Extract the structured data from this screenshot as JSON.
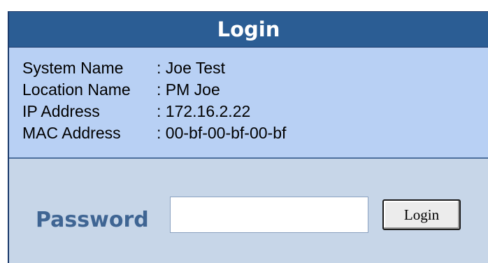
{
  "header": {
    "title": "Login"
  },
  "system_info": {
    "rows": [
      {
        "label": "System Name",
        "value": ": Joe Test"
      },
      {
        "label": "Location Name",
        "value": ": PM Joe"
      },
      {
        "label": "IP Address",
        "value": ": 172.16.2.22"
      },
      {
        "label": "MAC Address",
        "value": ": 00-bf-00-bf-00-bf"
      }
    ]
  },
  "login_form": {
    "password_label": "Password",
    "password_value": "",
    "login_button_label": "Login"
  },
  "colors": {
    "title_bar": "#2b5d94",
    "info_background": "#b8d0f4",
    "login_background": "#c7d6e8",
    "password_label": "#3f6593"
  }
}
